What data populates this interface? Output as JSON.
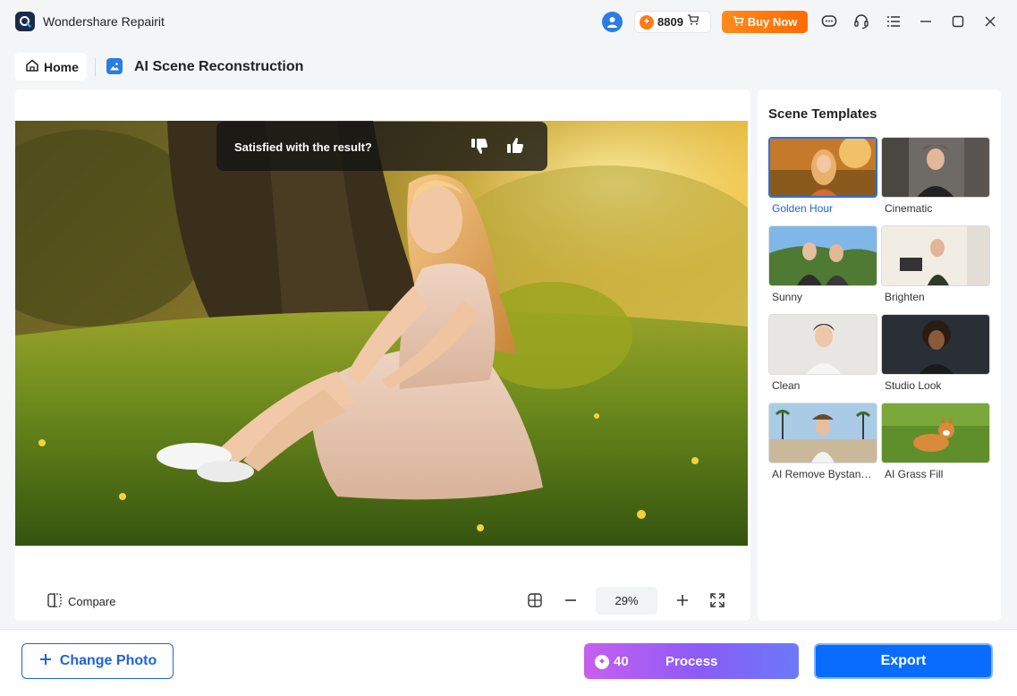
{
  "window": {
    "title": "Wondershare Repairit",
    "credits": "8809",
    "buy_now_label": "Buy Now"
  },
  "breadcrumb": {
    "home_label": "Home",
    "feature_title": "AI Scene Reconstruction"
  },
  "preview": {
    "feedback_question": "Satisfied with the result?",
    "compare_label": "Compare",
    "zoom_level": "29%"
  },
  "templates": {
    "title": "Scene Templates",
    "items": [
      {
        "label": "Golden Hour",
        "selected": true
      },
      {
        "label": "Cinematic"
      },
      {
        "label": "Sunny"
      },
      {
        "label": "Brighten"
      },
      {
        "label": "Clean"
      },
      {
        "label": "Studio Look"
      },
      {
        "label": "AI Remove Bystand..."
      },
      {
        "label": "AI Grass Fill"
      }
    ]
  },
  "actions": {
    "change_photo_label": "Change Photo",
    "process_cost": "40",
    "process_label": "Process",
    "export_label": "Export"
  },
  "colors": {
    "accent": "#1f63d8",
    "buy_now": "#ff7a18",
    "export": "#0a6cff"
  }
}
